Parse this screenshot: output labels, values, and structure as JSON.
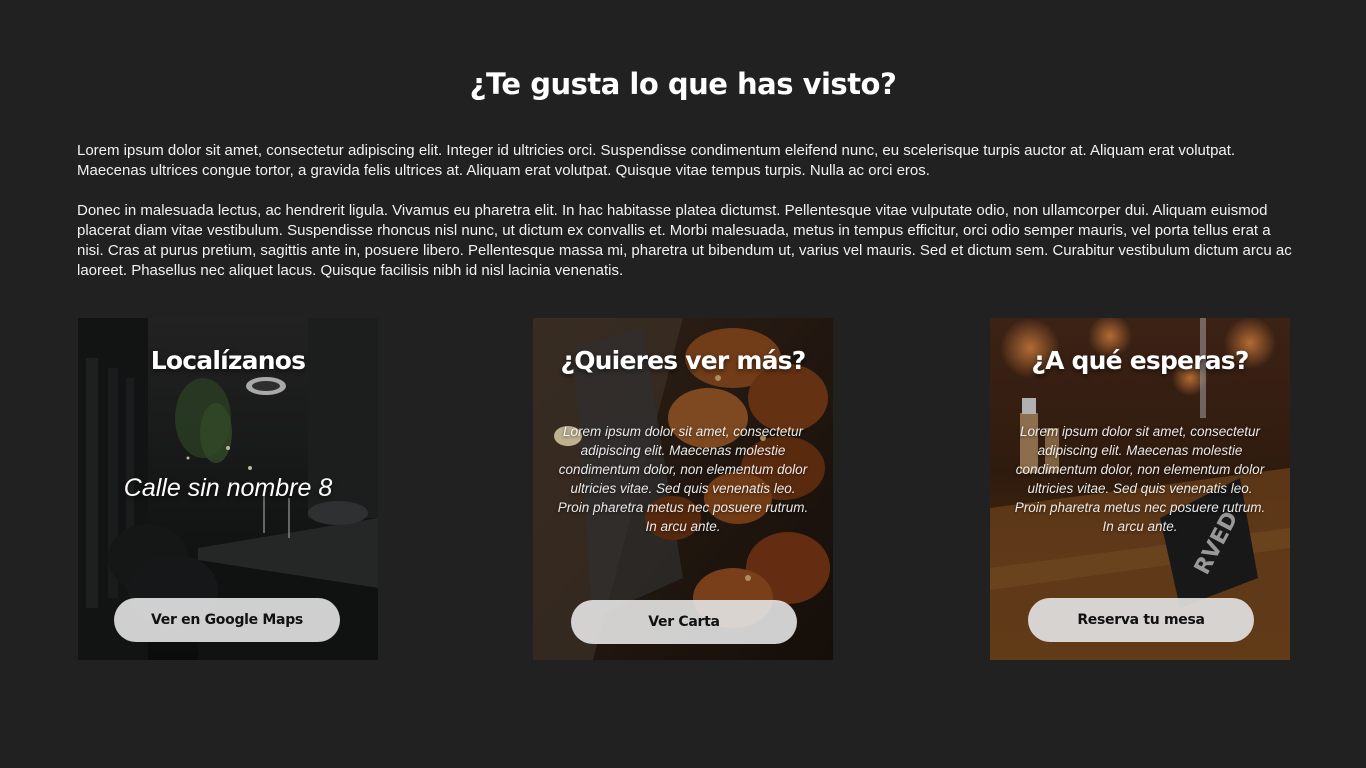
{
  "section": {
    "title": "¿Te gusta lo que has visto?",
    "paragraphs": [
      "Lorem ipsum dolor sit amet, consectetur adipiscing elit. Integer id ultricies orci. Suspendisse condimentum eleifend nunc, eu scelerisque turpis auctor at. Aliquam erat volutpat. Maecenas ultrices congue tortor, a gravida felis ultrices at. Aliquam erat volutpat. Quisque vitae tempus turpis. Nulla ac orci eros.",
      "Donec in malesuada lectus, ac hendrerit ligula. Vivamus eu pharetra elit. In hac habitasse platea dictumst. Pellentesque vitae vulputate odio, non ullamcorper dui. Aliquam euismod placerat diam vitae vestibulum. Suspendisse rhoncus nisl nunc, ut dictum ex convallis et. Morbi malesuada, metus in tempus efficitur, orci odio semper mauris, vel porta tellus erat a nisi. Cras at purus pretium, sagittis ante in, posuere libero. Pellentesque massa mi, pharetra ut bibendum ut, varius vel mauris. Sed et dictum sem. Curabitur vestibulum dictum arcu ac laoreet. Phasellus nec aliquet lacus. Quisque facilisis nibh id nisl lacinia venenatis."
    ]
  },
  "cards": [
    {
      "title": "Localízanos",
      "address": "Calle sin nombre 8",
      "button": "Ver en Google Maps",
      "image": "restaurant-interior-photo"
    },
    {
      "title": "¿Quieres ver más?",
      "text": "Lorem ipsum dolor sit amet, consectetur adipiscing elit. Maecenas molestie condimentum dolor, non elementum dolor ultricies vitae. Sed quis venenatis leo. Proin pharetra metus nec posuere rutrum. In arcu ante.",
      "button": "Ver Carta",
      "image": "grilled-chicken-wings-photo"
    },
    {
      "title": "¿A qué esperas?",
      "text": "Lorem ipsum dolor sit amet, consectetur adipiscing elit. Maecenas molestie condimentum dolor, non elementum dolor ultricies vitae. Sed quis venenatis leo. Proin pharetra metus nec posuere rutrum. In arcu ante.",
      "button": "Reserva tu mesa",
      "image": "reserved-table-photo"
    }
  ],
  "colors": {
    "page_background": "#212121",
    "text": "#ffffff",
    "button_background": "#e4e4e4",
    "button_text": "#111111"
  }
}
